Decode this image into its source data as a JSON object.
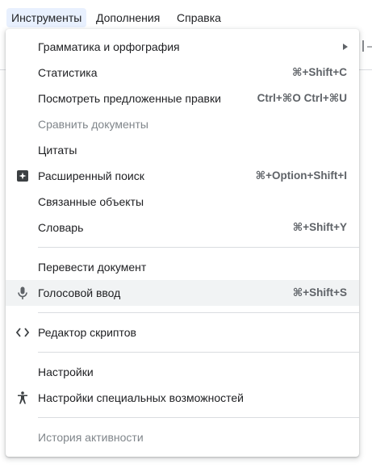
{
  "menubar": {
    "items": [
      {
        "label": "Инструменты"
      },
      {
        "label": "Дополнения"
      },
      {
        "label": "Справка"
      }
    ]
  },
  "menu": {
    "items": [
      {
        "label": "Грамматика и орфография",
        "shortcut": "",
        "submenu": true
      },
      {
        "label": "Статистика",
        "shortcut": "⌘+Shift+C"
      },
      {
        "label": "Посмотреть предложенные правки",
        "shortcut": "Ctrl+⌘O Ctrl+⌘U"
      },
      {
        "label": "Сравнить документы",
        "shortcut": "",
        "disabled": true
      },
      {
        "label": "Цитаты",
        "shortcut": ""
      },
      {
        "label": "Расширенный поиск",
        "shortcut": "⌘+Option+Shift+I",
        "icon": "explore-sparkle-icon"
      },
      {
        "label": "Связанные объекты",
        "shortcut": ""
      },
      {
        "label": "Словарь",
        "shortcut": "⌘+Shift+Y"
      },
      {
        "label": "Перевести документ",
        "shortcut": ""
      },
      {
        "label": "Голосовой ввод",
        "shortcut": "⌘+Shift+S",
        "icon": "microphone-icon",
        "highlighted": true
      },
      {
        "label": "Редактор скриптов",
        "shortcut": "",
        "icon": "code-brackets-icon"
      },
      {
        "label": "Настройки",
        "shortcut": ""
      },
      {
        "label": "Настройки специальных возможностей",
        "shortcut": "",
        "icon": "accessibility-icon"
      },
      {
        "label": "История активности",
        "shortcut": "",
        "disabled": true
      }
    ]
  },
  "colors": {
    "active_tab_bg": "#e8f0fe",
    "highlight_bg": "#f1f3f4",
    "disabled_text": "#80868b",
    "shortcut_text": "#5f6368"
  }
}
